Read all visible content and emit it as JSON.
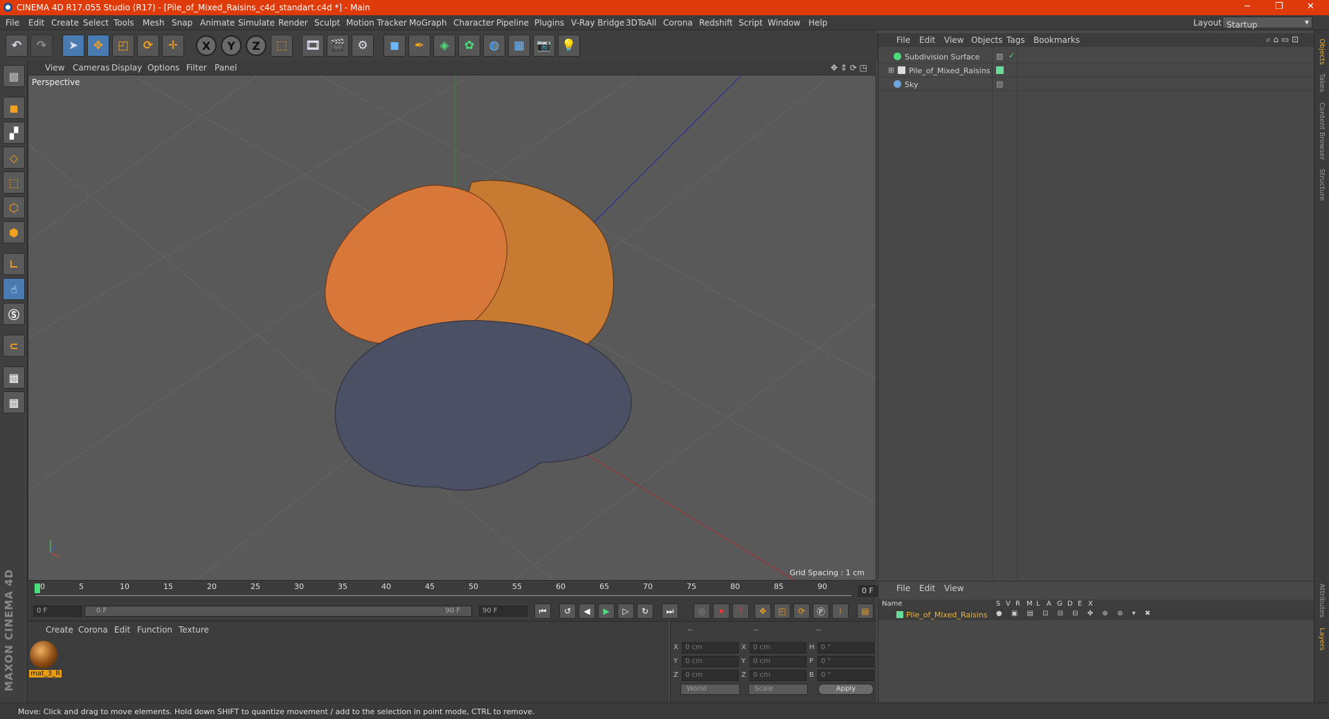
{
  "window": {
    "title": "CINEMA 4D R17.055 Studio (R17) - [Pile_of_Mixed_Raisins_c4d_standart.c4d *] - Main",
    "min": "─",
    "max": "❐",
    "close": "✕"
  },
  "menu": [
    "File",
    "Edit",
    "Create",
    "Select",
    "Tools",
    "Mesh",
    "Snap",
    "Animate",
    "Simulate",
    "Render",
    "Sculpt",
    "Motion Tracker",
    "MoGraph",
    "Character",
    "Pipeline",
    "Plugins",
    "V-Ray Bridge",
    "3DToAll",
    "Corona",
    "Redshift",
    "Script",
    "Window",
    "Help"
  ],
  "layout": {
    "label": "Layout:",
    "value": "Startup"
  },
  "viewport": {
    "menu": [
      "View",
      "Cameras",
      "Display",
      "Options",
      "Filter",
      "Panel"
    ],
    "label": "Perspective",
    "grid_spacing": "Grid Spacing : 1 cm"
  },
  "timeline": {
    "ticks": [
      "0",
      "5",
      "10",
      "15",
      "20",
      "25",
      "30",
      "35",
      "40",
      "45",
      "50",
      "55",
      "60",
      "65",
      "70",
      "75",
      "80",
      "85",
      "90"
    ],
    "frame": "0 F"
  },
  "transport": {
    "start": "0 F",
    "range_start": "0 F",
    "range_end": "90 F",
    "end": "90 F"
  },
  "material_panel": {
    "menu": [
      "Create",
      "Corona",
      "Edit",
      "Function",
      "Texture"
    ],
    "material_name": "mat_3_R"
  },
  "coordinates": {
    "headers": [
      "--",
      "--",
      "--"
    ],
    "pos": {
      "x": "0 cm",
      "y": "0 cm",
      "z": "0 cm"
    },
    "size": {
      "x": "0 cm",
      "y": "0 cm",
      "z": "0 cm"
    },
    "rot": {
      "h": "0 °",
      "p": "0 °",
      "b": "0 °"
    },
    "labels": {
      "x": "X",
      "y": "Y",
      "z": "Z",
      "h": "H",
      "p": "P",
      "b": "B"
    },
    "world": "World",
    "scale": "Scale",
    "apply": "Apply"
  },
  "objects": {
    "menu": [
      "File",
      "Edit",
      "View",
      "Objects",
      "Tags",
      "Bookmarks"
    ],
    "items": [
      {
        "name": "Subdivision Surface",
        "color": "#4bdc7a"
      },
      {
        "name": "Pile_of_Mixed_Raisins",
        "color": "#e0e0e0"
      },
      {
        "name": "Sky",
        "color": "#6ca6e0"
      }
    ]
  },
  "layers": {
    "menu": [
      "File",
      "Edit",
      "View"
    ],
    "columns": [
      "Name",
      "S",
      "V",
      "R",
      "M",
      "L",
      "A",
      "G",
      "D",
      "E",
      "X"
    ],
    "item": "Pile_of_Mixed_Raisins",
    "item_color": "#6adc9a"
  },
  "right_tabs": [
    "Objects",
    "Takes",
    "Content Browser",
    "Structure",
    "Attributes",
    "Layers"
  ],
  "brand": "MAXON CINEMA 4D",
  "status": "Move: Click and drag to move elements. Hold down SHIFT to quantize movement / add to the selection in point mode, CTRL to remove."
}
